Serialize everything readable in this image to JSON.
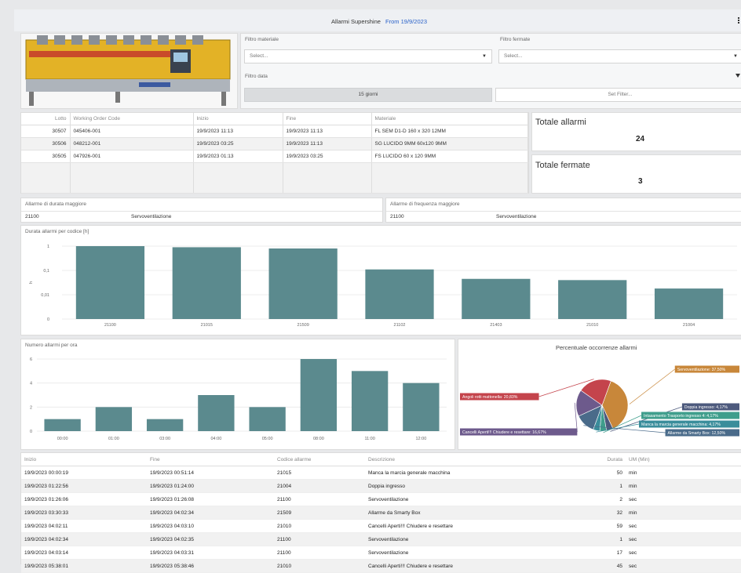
{
  "header": {
    "title": "Allarmi Supershine",
    "from_label": "From 19/9/2023",
    "menu_icon": "ellipsis-icon"
  },
  "filters": {
    "material": {
      "label": "Filtro materiale",
      "value": "Select..."
    },
    "stops": {
      "label": "Filtro fermate",
      "value": "Select..."
    },
    "date": {
      "label": "Filtro data",
      "preset": "15 giorni",
      "set_filter": "Set Filter..."
    },
    "filter_icon": "funnel-icon"
  },
  "orders": {
    "columns": [
      "Lotto",
      "Working Order Code",
      "Inizio",
      "Fine",
      "Materiale"
    ],
    "rows": [
      [
        "30507",
        "045406-001",
        "19/9/2023 11:13",
        "19/9/2023 11:13",
        "FL SEM D1-D 160 x 320 12MM"
      ],
      [
        "30506",
        "048212-001",
        "19/9/2023 03:25",
        "19/9/2023 11:13",
        "SG LUCIDO 9MM 60x120 9MM"
      ],
      [
        "30505",
        "047926-001",
        "19/9/2023 01:13",
        "19/9/2023 03:25",
        "FS LUCIDO 60 x 120 9MM"
      ]
    ]
  },
  "totals": {
    "alarms_label": "Totale allarmi",
    "alarms_value": "24",
    "stops_label": "Totale fermate",
    "stops_value": "3"
  },
  "longest": {
    "label": "Allarme di durata maggiore",
    "code": "21100",
    "desc": "Servoventilazione"
  },
  "frequent": {
    "label": "Allarme di frequenza maggiore",
    "code": "21100",
    "desc": "Servoventilazione"
  },
  "chart_data": [
    {
      "type": "bar",
      "title": "Durata allarmi per codice [h]",
      "categories": [
        "21100",
        "21015",
        "21509",
        "21102",
        "21403",
        "21010",
        "21004"
      ],
      "values": [
        1,
        0.9,
        0.8,
        0.11,
        0.045,
        0.04,
        0.018
      ],
      "yscale": "log",
      "yticks": [
        "0",
        "0,01",
        "0,1",
        "1"
      ],
      "ylabel": "h",
      "color": "#5b8a8e"
    },
    {
      "type": "bar",
      "title": "Numero allarmi per ora",
      "categories": [
        "00:00",
        "01:00",
        "03:00",
        "04:00",
        "05:00",
        "08:00",
        "11:00",
        "12:00"
      ],
      "values": [
        1,
        2,
        1,
        3,
        2,
        6,
        5,
        4
      ],
      "ylim": [
        0,
        6
      ],
      "yticks": [
        "0",
        "2",
        "4",
        "6"
      ],
      "color": "#5b8a8e"
    },
    {
      "type": "pie",
      "title": "Percentuale occorrenze allarmi",
      "slices": [
        {
          "label": "Servoventilazione: 37,50%",
          "value": 37.5,
          "color": "#c8873a"
        },
        {
          "label": "Doppia ingresso: 4,17%",
          "value": 4.17,
          "color": "#4d5a7d"
        },
        {
          "label": "Intasamento Trasporto ingresso 4: 4,17%",
          "value": 4.17,
          "color": "#3f9e8c"
        },
        {
          "label": "Manca la marcia generale macchina: 4,17%",
          "value": 4.17,
          "color": "#3a8d9b"
        },
        {
          "label": "Allarme da Smarty Box: 12,50%",
          "value": 12.5,
          "color": "#4a6b8a"
        },
        {
          "label": "Cancelli Aperti!!! Chiudere e resettare: 16,67%",
          "value": 16.67,
          "color": "#6d5a8c"
        },
        {
          "label": "Angoli rotti mattonella: 20,83%",
          "value": 20.83,
          "color": "#c4444c"
        }
      ]
    }
  ],
  "alarms": {
    "columns": [
      "Inizio",
      "Fine",
      "Codice allarme",
      "Descrizione",
      "Durata",
      "UM (Min)"
    ],
    "rows": [
      [
        "19/9/2023 00:00:19",
        "19/9/2023 00:51:14",
        "21015",
        "Manca la marcia generale macchina",
        "50",
        "min"
      ],
      [
        "19/9/2023 01:22:56",
        "19/9/2023 01:24:00",
        "21004",
        "Doppia ingresso",
        "1",
        "min"
      ],
      [
        "19/9/2023 01:26:06",
        "19/9/2023 01:26:08",
        "21100",
        "Servoventilazione",
        "2",
        "sec"
      ],
      [
        "19/9/2023 03:30:33",
        "19/9/2023 04:02:34",
        "21509",
        "Allarme da Smarty Box",
        "32",
        "min"
      ],
      [
        "19/9/2023 04:02:11",
        "19/9/2023 04:03:10",
        "21010",
        "Cancelli Aperti!!! Chiudere e resettare",
        "59",
        "sec"
      ],
      [
        "19/9/2023 04:02:34",
        "19/9/2023 04:02:35",
        "21100",
        "Servoventilazione",
        "1",
        "sec"
      ],
      [
        "19/9/2023 04:03:14",
        "19/9/2023 04:03:31",
        "21100",
        "Servoventilazione",
        "17",
        "sec"
      ],
      [
        "19/9/2023 05:38:01",
        "19/9/2023 05:38:46",
        "21010",
        "Cancelli Aperti!!! Chiudere e resettare",
        "45",
        "sec"
      ]
    ]
  }
}
